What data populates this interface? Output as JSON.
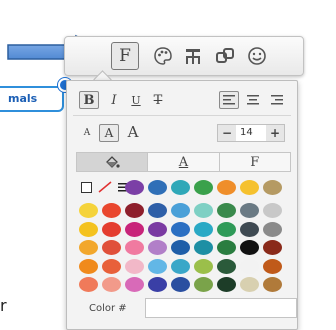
{
  "node": {
    "label": "mals"
  },
  "toolbar": {
    "buttons": [
      {
        "name": "format-button",
        "icon": "format-F-icon",
        "label": "F",
        "active": true
      },
      {
        "name": "palette-button",
        "icon": "palette-icon",
        "active": false
      },
      {
        "name": "layout-button",
        "icon": "hierarchy-icon",
        "active": false
      },
      {
        "name": "link-button",
        "icon": "link-icon",
        "active": false
      },
      {
        "name": "emoji-button",
        "icon": "smiley-icon",
        "active": false
      }
    ]
  },
  "text_format": {
    "bold": "B",
    "italic": "I",
    "underline": "U",
    "strike": "T",
    "size_small": "A",
    "size_medium": "A",
    "size_large": "A",
    "font_size": "14",
    "minus": "−",
    "plus": "+"
  },
  "tabs": [
    {
      "name": "fill",
      "label": "",
      "icon": "paint-bucket-icon",
      "active": true
    },
    {
      "name": "text-color",
      "label": "A",
      "active": false
    },
    {
      "name": "font",
      "label": "F",
      "active": false
    }
  ],
  "palette": {
    "rows": [
      [
        "#7b3fa6",
        "#2f6fb7",
        "#2fa8b8",
        "#3aa14b",
        "#ef8e2a",
        "#f5c12e",
        "#b59a63"
      ],
      [
        "#f5d33a",
        "#e9472e",
        "#8e1f2c",
        "#2e5fa8",
        "#4aa0d8",
        "#7ed0c4",
        "#3a8a4c",
        "#6a7a84",
        "#c8c8c8"
      ],
      [
        "#f4c21f",
        "#e43d2f",
        "#c8247a",
        "#7a3aa2",
        "#2b6fc2",
        "#2aa9c5",
        "#2f9a58",
        "#3f4a52",
        "#8a8a8a"
      ],
      [
        "#f2a72c",
        "#e0503a",
        "#f07aa0",
        "#b17fc8",
        "#1f5ea8",
        "#1e8fa4",
        "#2a7d40",
        "#111111",
        "#8a2a1a"
      ],
      [
        "#f08a1c",
        "#e8603a",
        "#f2b8c8",
        "#62b7e6",
        "#3aa7c8",
        "#9bbf4a",
        "#2a5a3a",
        "#f2f2f2",
        "#c05a1a"
      ],
      [
        "#f07a5a",
        "#f29a8a",
        "#d86ab8",
        "#3a3fa6",
        "#2a4fa0",
        "#7aa34a",
        "#1d3d28",
        "#d8d0b0",
        "#b07a3a"
      ]
    ]
  },
  "color_field": {
    "label": "Color #",
    "value": ""
  },
  "partial_text": "r"
}
